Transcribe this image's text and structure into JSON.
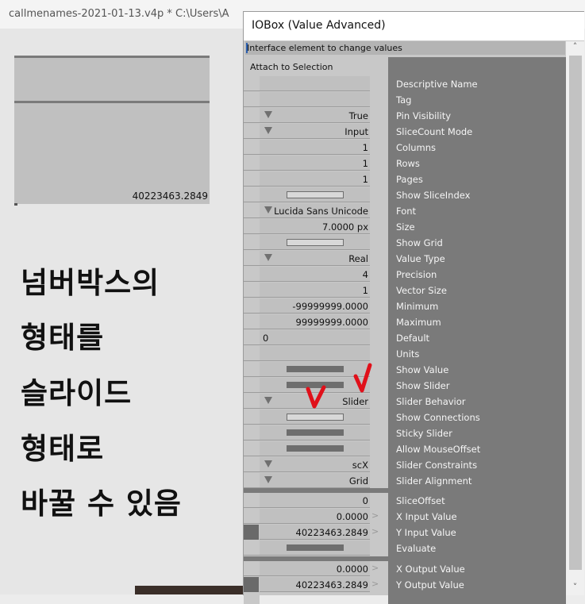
{
  "window": {
    "title": "callmenames-2021-01-13.v4p *   C:\\Users\\A"
  },
  "patch": {
    "numberbox_value": "40223463.2849",
    "annotation_lines": [
      "넘버박스의",
      "형태를",
      "슬라이드",
      "형태로",
      "바꿀 수 있음"
    ]
  },
  "inspector": {
    "title": "IOBox (Value Advanced)",
    "header": "Interface element to change values",
    "attach_label": "Attach to Selection",
    "pins": [
      {
        "label": "Descriptive Name",
        "value": ""
      },
      {
        "label": "Tag",
        "value": ""
      },
      {
        "label": "Pin Visibility",
        "value": "True"
      },
      {
        "label": "SliceCount Mode",
        "value": "Input"
      },
      {
        "label": "Columns",
        "value": "1"
      },
      {
        "label": "Rows",
        "value": "1"
      },
      {
        "label": "Pages",
        "value": "1"
      },
      {
        "label": "Show SliceIndex",
        "value": ""
      },
      {
        "label": "Font",
        "value": "Lucida Sans Unicode"
      },
      {
        "label": "Size",
        "value": "7.0000 px"
      },
      {
        "label": "Show Grid",
        "value": ""
      },
      {
        "label": "Value Type",
        "value": "Real"
      },
      {
        "label": "Precision",
        "value": "4"
      },
      {
        "label": "Vector Size",
        "value": "1"
      },
      {
        "label": "Minimum",
        "value": "-99999999.0000"
      },
      {
        "label": "Maximum",
        "value": "99999999.0000"
      },
      {
        "label": "Default",
        "value": "0"
      },
      {
        "label": "Units",
        "value": ""
      },
      {
        "label": "Show Value",
        "value": ""
      },
      {
        "label": "Show Slider",
        "value": ""
      },
      {
        "label": "Slider Behavior",
        "value": "Slider"
      },
      {
        "label": "Show Connections",
        "value": ""
      },
      {
        "label": "Sticky Slider",
        "value": ""
      },
      {
        "label": "Allow MouseOffset",
        "value": ""
      },
      {
        "label": "Slider Constraints",
        "value": "scX"
      },
      {
        "label": "Slider Alignment",
        "value": "Grid"
      }
    ],
    "input_pins": [
      {
        "label": "SliceOffset",
        "value": "0"
      },
      {
        "label": "X Input Value",
        "value": "0.0000"
      },
      {
        "label": "Y Input Value",
        "value": "40223463.2849"
      },
      {
        "label": "Evaluate",
        "value": ""
      }
    ],
    "output_pins": [
      {
        "label": "X Output Value",
        "value": "0.0000"
      },
      {
        "label": "Y Output Value",
        "value": "40223463.2849"
      }
    ]
  },
  "colors": {
    "check_marks": "#e0101a",
    "label_pane": "#7a7a7a"
  }
}
